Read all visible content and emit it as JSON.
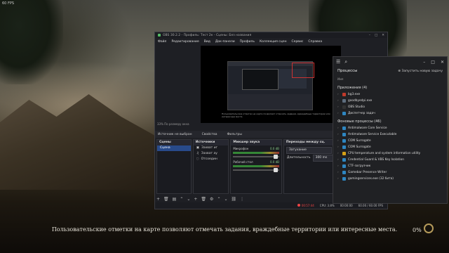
{
  "overlay": {
    "fps_top": "60 FPS"
  },
  "game": {
    "subtitle": "Пользовательские отметки на карте позволяют отмечать задания, враждебные территории или интересные места.",
    "progress_percent": "0%"
  },
  "obs": {
    "title": "OBS 30.2.2 - Профиль: Тест 2к - Сцены: Без названия",
    "menu": [
      "Файл",
      "Редактирование",
      "Вид",
      "Док-панели",
      "Профиль",
      "Коллекция сцен",
      "Сервис",
      "Справка"
    ],
    "preview_caption": "Пользовательские отметки на карте позволяют отмечать задания, враждебные территории или интересные места.",
    "preview_status": "33% По размеру окна",
    "source_bar": {
      "no_source": "Источник не выбран",
      "properties": "Свойства",
      "filters": "Фильтры"
    },
    "scenes": {
      "title": "Сцены",
      "items": [
        "Сцена"
      ]
    },
    "sources": {
      "title": "Источники",
      "items": [
        "Захват иг",
        "Захват ау",
        "Отсоедин"
      ]
    },
    "mixer": {
      "title": "Микшер звука",
      "channels": [
        {
          "name": "Микрофон",
          "db": "0.0 dB"
        },
        {
          "name": "Рабочий стол",
          "db": "0.0 dB"
        }
      ]
    },
    "transitions": {
      "title": "Переходы между сц.",
      "type": "Затухание",
      "duration_label": "Длительность",
      "duration_value": "300 ms"
    },
    "status": {
      "rec_time": "00:57:44",
      "cpu": "CPU: 3.8%",
      "fps": "60.00 / 60.00 FPS",
      "time2": "00:00:00"
    }
  },
  "taskmgr": {
    "heading": "Процессы",
    "new_task": "Запустить новую задачу",
    "column": "Имя",
    "apps_group": "Приложения (4)",
    "apps": [
      {
        "name": "bg3.exe",
        "color": "#c0392b"
      },
      {
        "name": "goodbyedpi.exe",
        "color": "#5d6d7e"
      },
      {
        "name": "OBS Studio",
        "color": "#333333"
      },
      {
        "name": "Диспетчер задач",
        "color": "#2e86c1"
      }
    ],
    "bg_group": "Фоновые процессы (46)",
    "bg": [
      {
        "name": "Antimalware Core Service",
        "color": "#2e86c1"
      },
      {
        "name": "Antimalware Service Executable",
        "color": "#2e86c1"
      },
      {
        "name": "COM Surrogate",
        "color": "#2e86c1"
      },
      {
        "name": "COM Surrogate",
        "color": "#2e86c1"
      },
      {
        "name": "CPU temperature and system information utility",
        "color": "#d4a017"
      },
      {
        "name": "Credential Guard & VBS Key Isolation",
        "color": "#2e86c1"
      },
      {
        "name": "CTF-загрузчик",
        "color": "#2e86c1"
      },
      {
        "name": "Gamebar Presence Writer",
        "color": "#2e86c1"
      },
      {
        "name": "gamingservices.exe (32 бита)",
        "color": "#2e86c1"
      }
    ]
  }
}
